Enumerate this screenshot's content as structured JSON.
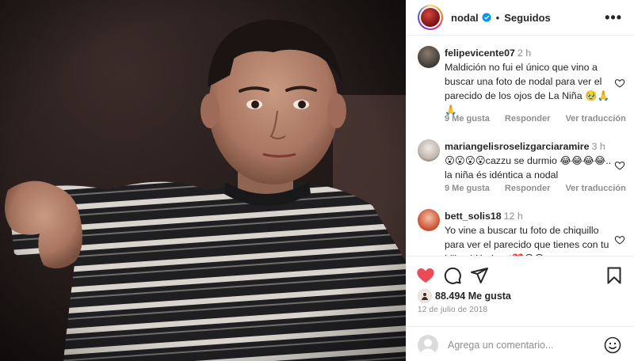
{
  "post": {
    "image_alt": "Vintage photo of a young boy in a striped shirt",
    "owner": "nodal",
    "follow_state": "Seguidos",
    "dot": "•"
  },
  "comments": [
    {
      "username": "felipevicente07",
      "time": "2 h",
      "text": "Maldición no fui el único que vino a buscar una foto de nodal para ver el parecido de los ojos de La Niña 🥹🙏🙏",
      "likes": "9 Me gusta",
      "reply": "Responder",
      "translate": "Ver traducción",
      "avatar_color": "#3d3a36"
    },
    {
      "username": "mariangelisroselizgarciaramire",
      "time": "3 h",
      "text": "😮😮😮😮cazzu se durmio 😂😂😂😂.. la niña és idéntica a nodal",
      "likes": "9 Me gusta",
      "reply": "Responder",
      "translate": "Ver traducción",
      "avatar_color": "#c7c2bf"
    },
    {
      "username": "bett_solis18",
      "time": "12 h",
      "text": "Yo vine a buscar tu foto de chiquillo para ver el parecido que tienes con tu hiiita, idénticos!❤️😮😍",
      "likes": "",
      "reply": "",
      "translate": "",
      "avatar_color": "#c94b2f"
    }
  ],
  "actions": {
    "likes_count": "88.494 Me gusta",
    "date": "12 de julio de 2018",
    "liked": true,
    "like_color": "#ed4956"
  },
  "add_comment": {
    "placeholder": "Agrega un comentario..."
  },
  "icons": {
    "verified": "verified-badge-icon",
    "more": "more-options-icon",
    "heart": "heart-icon",
    "comment": "comment-icon",
    "share": "share-icon",
    "save": "bookmark-icon",
    "emoji": "emoji-icon"
  }
}
